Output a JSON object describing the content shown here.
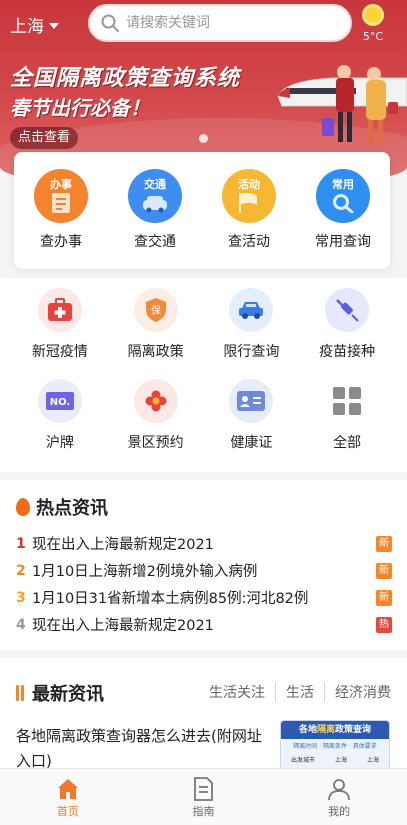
{
  "header": {
    "city": "上海",
    "search_placeholder": "请搜索关键词",
    "weather": {
      "temp": "5°C",
      "icon": "sun-icon"
    }
  },
  "banner": {
    "headline": "全国隔离政策查询系统",
    "subheadline": "春节出行必备！",
    "button_label": "点击查看"
  },
  "quick_actions": [
    {
      "tag": "办事",
      "label": "查办事",
      "icon": "document-icon",
      "color": "#f4832d"
    },
    {
      "tag": "交通",
      "label": "查交通",
      "icon": "car-icon",
      "color": "#3d8ef0"
    },
    {
      "tag": "活动",
      "label": "查活动",
      "icon": "flag-icon",
      "color": "#f6b734"
    },
    {
      "tag": "常用",
      "label": "常用查询",
      "icon": "search-icon",
      "color": "#2e8ff0"
    }
  ],
  "services": {
    "row1": [
      {
        "label": "新冠疫情",
        "icon": "medical-kit-icon"
      },
      {
        "label": "隔离政策",
        "icon": "shield-icon"
      },
      {
        "label": "限行查询",
        "icon": "car-icon"
      },
      {
        "label": "疫苗接种",
        "icon": "syringe-icon"
      }
    ],
    "row2": [
      {
        "label": "沪牌",
        "icon": "license-plate-icon"
      },
      {
        "label": "景区预约",
        "icon": "flower-icon"
      },
      {
        "label": "健康证",
        "icon": "id-card-icon"
      },
      {
        "label": "全部",
        "icon": "grid-icon"
      }
    ]
  },
  "hot_news": {
    "title": "热点资讯",
    "items": [
      {
        "rank": "1",
        "text": "现在出入上海最新规定2021",
        "badge": "新"
      },
      {
        "rank": "2",
        "text": "1月10日上海新增2例境外输入病例",
        "badge": "新"
      },
      {
        "rank": "3",
        "text": "1月10日31省新增本土病例85例:河北82例",
        "badge": "新"
      },
      {
        "rank": "4",
        "text": "现在出入上海最新规定2021",
        "badge": "热"
      }
    ]
  },
  "latest_news": {
    "title": "最新资讯",
    "tabs": [
      "生活关注",
      "生活",
      "经济消费"
    ],
    "article_title": "各地隔离政策查询器怎么进去(附网址入口)",
    "thumb": {
      "title_prefix": "各地",
      "title_highlight": "隔离",
      "title_suffix": "政策查询",
      "subtitle": "隔离时间 · 隔离条件 · 具体要求",
      "from_label": "出发城市",
      "from_value": "上海",
      "to_value": "上海"
    }
  },
  "bottom_nav": [
    {
      "label": "首页",
      "icon": "home-icon",
      "active": true
    },
    {
      "label": "指南",
      "icon": "guide-icon",
      "active": false
    },
    {
      "label": "我的",
      "icon": "user-icon",
      "active": false
    }
  ],
  "colors": {
    "primary": "#c8363c",
    "accent": "#f2782a",
    "rank1": "#d8332a",
    "rank2": "#f2882a",
    "rank3": "#f2a12a",
    "rank4": "#999999",
    "badge_new": "#f2882a",
    "badge_hot": "#e8473f"
  }
}
